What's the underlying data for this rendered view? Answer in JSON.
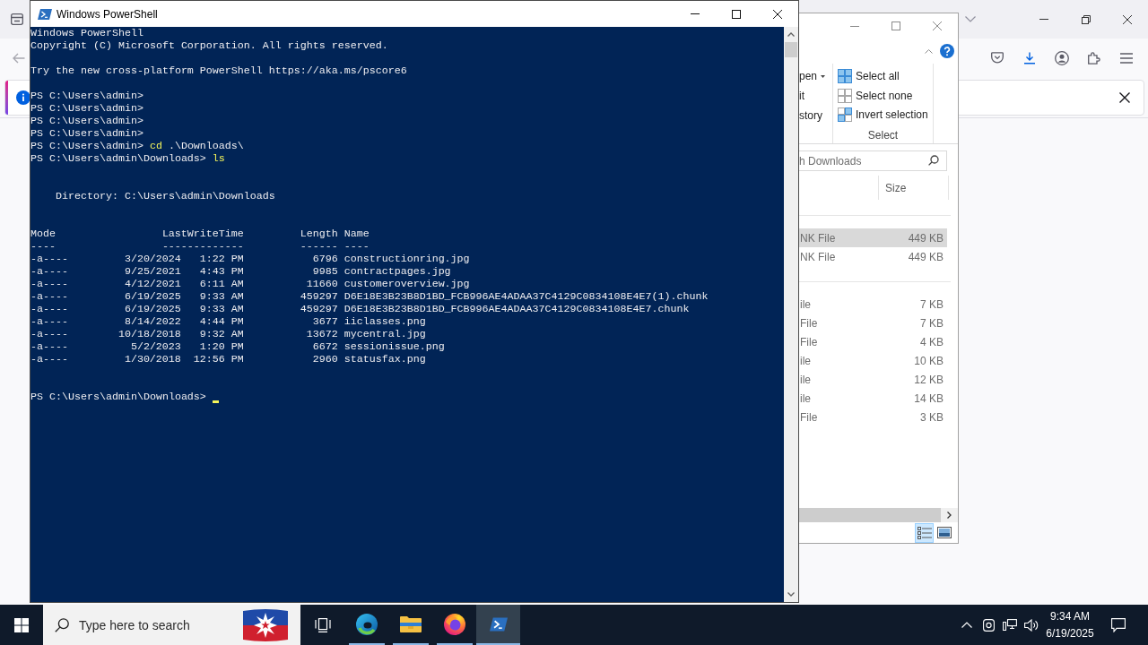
{
  "powershell": {
    "title": "Windows PowerShell",
    "banner": [
      "Windows PowerShell",
      "Copyright (C) Microsoft Corporation. All rights reserved."
    ],
    "notice": "Try the new cross-platform PowerShell https://aka.ms/pscore6",
    "history": [
      {
        "prompt": "PS C:\\Users\\admin>"
      },
      {
        "prompt": "PS C:\\Users\\admin>"
      },
      {
        "prompt": "PS C:\\Users\\admin>"
      },
      {
        "prompt": "PS C:\\Users\\admin>"
      },
      {
        "prompt": "PS C:\\Users\\admin>",
        "command": "cd",
        "argument": ".\\Downloads\\"
      },
      {
        "prompt": "PS C:\\Users\\admin\\Downloads>",
        "command": "ls"
      }
    ],
    "listing": {
      "directory": "Directory: C:\\Users\\admin\\Downloads",
      "columns": [
        {
          "heading": "Mode",
          "rule": "----"
        },
        {
          "heading": "LastWriteTime",
          "rule": "-------------"
        },
        {
          "heading": "Length",
          "rule": "------"
        },
        {
          "heading": "Name",
          "rule": "----"
        }
      ],
      "rows": [
        {
          "mode": "-a----",
          "date": "3/20/2024",
          "time": "1:22 PM",
          "length": "6796",
          "name": "constructionring.jpg"
        },
        {
          "mode": "-a----",
          "date": "9/25/2021",
          "time": "4:43 PM",
          "length": "9985",
          "name": "contractpages.jpg"
        },
        {
          "mode": "-a----",
          "date": "4/12/2021",
          "time": "6:11 AM",
          "length": "11660",
          "name": "customeroverview.jpg"
        },
        {
          "mode": "-a----",
          "date": "6/19/2025",
          "time": "9:33 AM",
          "length": "459297",
          "name": "D6E18E3B23B8D1BD_FCB996AE4ADAA37C4129C0834108E4E7(1).chunk"
        },
        {
          "mode": "-a----",
          "date": "6/19/2025",
          "time": "9:33 AM",
          "length": "459297",
          "name": "D6E18E3B23B8D1BD_FCB996AE4ADAA37C4129C0834108E4E7.chunk"
        },
        {
          "mode": "-a----",
          "date": "8/14/2022",
          "time": "4:44 PM",
          "length": "3677",
          "name": "iiclasses.png"
        },
        {
          "mode": "-a----",
          "date": "10/18/2018",
          "time": "9:32 AM",
          "length": "13672",
          "name": "mycentral.jpg"
        },
        {
          "mode": "-a----",
          "date": "5/2/2023",
          "time": "1:20 PM",
          "length": "6672",
          "name": "sessionissue.png"
        },
        {
          "mode": "-a----",
          "date": "1/30/2018",
          "time": "12:56 PM",
          "length": "2960",
          "name": "statusfax.png"
        }
      ]
    },
    "prompt": "PS C:\\Users\\admin\\Downloads>"
  },
  "explorer": {
    "ribbon": {
      "open_group": [
        {
          "label": "pen",
          "dropdown": true
        },
        {
          "label": "it",
          "dropdown": false
        },
        {
          "label": "story",
          "dropdown": false
        }
      ],
      "select_group": {
        "label": "Select",
        "commands": [
          {
            "kind": "all",
            "label": "Select all"
          },
          {
            "kind": "none",
            "label": "Select none"
          },
          {
            "kind": "invert",
            "label": "Invert selection"
          }
        ]
      }
    },
    "search": {
      "placeholder": "h Downloads"
    },
    "columns": [
      "Size"
    ],
    "groups": [
      {
        "rows": [
          {
            "type": "NK File",
            "size": "449 KB",
            "selected": true
          },
          {
            "type": "NK File",
            "size": "449 KB",
            "selected": false
          }
        ]
      },
      {
        "rows": [
          {
            "type": "ile",
            "size": "7 KB",
            "selected": false
          },
          {
            "type": "File",
            "size": "7 KB",
            "selected": false
          },
          {
            "type": "File",
            "size": "4 KB",
            "selected": false
          },
          {
            "type": "ile",
            "size": "10 KB",
            "selected": false
          },
          {
            "type": "ile",
            "size": "12 KB",
            "selected": false
          },
          {
            "type": "ile",
            "size": "14 KB",
            "selected": false
          },
          {
            "type": "File",
            "size": "3 KB",
            "selected": false
          }
        ]
      }
    ],
    "views": [
      {
        "kind": "details",
        "selected": true
      },
      {
        "kind": "preview",
        "selected": false
      }
    ]
  },
  "taskbar": {
    "search": {
      "placeholder": "Type here to search"
    },
    "apps": [
      {
        "kind": "edge",
        "running": true,
        "selected": false
      },
      {
        "kind": "folder",
        "running": true,
        "selected": false
      },
      {
        "kind": "firefox",
        "running": true,
        "selected": false
      },
      {
        "kind": "powershell",
        "running": true,
        "selected": true
      }
    ],
    "clock": {
      "time": "9:34 AM",
      "date": "6/19/2025"
    }
  }
}
